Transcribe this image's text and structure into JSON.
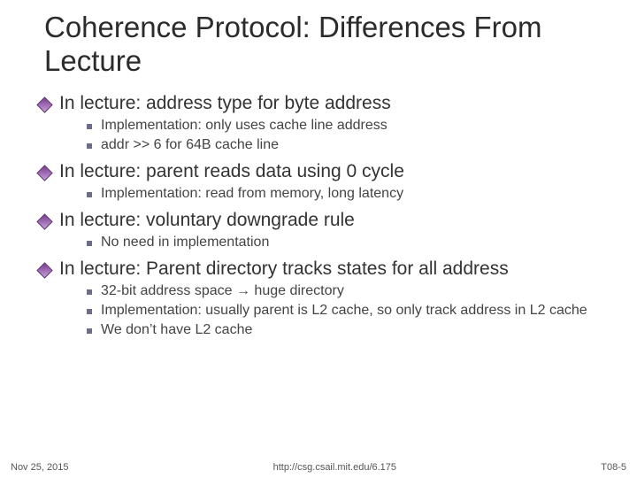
{
  "title": "Coherence Protocol: Differences From Lecture",
  "points": [
    {
      "text": "In lecture: address type for byte address",
      "sub": [
        "Implementation: only uses cache line address",
        "addr >> 6 for 64B cache line"
      ]
    },
    {
      "text": "In lecture: parent reads data using 0 cycle",
      "sub": [
        "Implementation: read from memory, long latency"
      ]
    },
    {
      "text": "In lecture: voluntary downgrade rule",
      "sub": [
        "No need in implementation"
      ]
    },
    {
      "text": "In lecture: Parent directory tracks states for all address",
      "sub": [
        "32-bit address space → huge directory",
        "Implementation: usually parent is L2 cache, so only track address in L2 cache",
        "We don’t have L2 cache"
      ]
    }
  ],
  "footer": {
    "date": "Nov 25, 2015",
    "url": "http://csg.csail.mit.edu/6.175",
    "page": "T08-5"
  }
}
